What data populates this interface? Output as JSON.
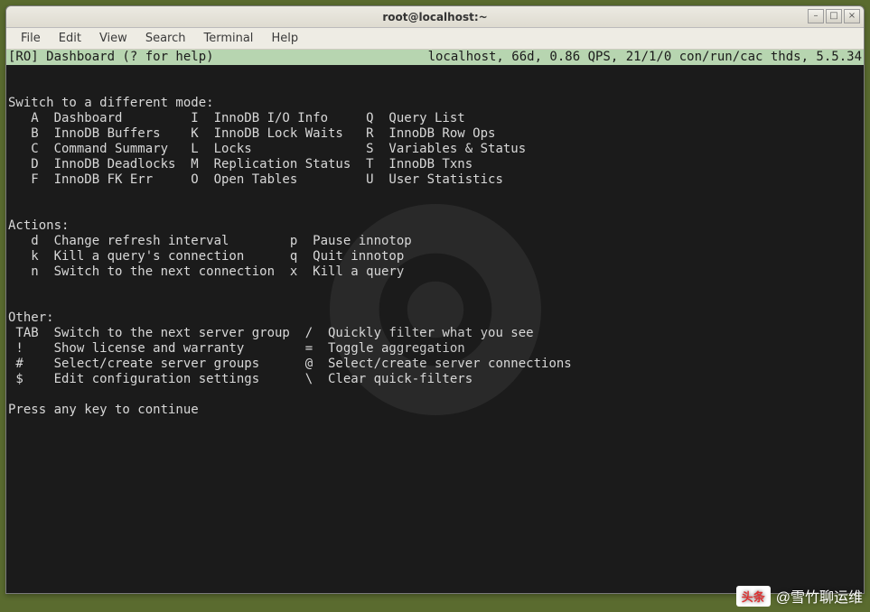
{
  "window": {
    "title": "root@localhost:~"
  },
  "menubar": [
    "File",
    "Edit",
    "View",
    "Search",
    "Terminal",
    "Help"
  ],
  "status": {
    "left": "[RO] Dashboard (? for help)",
    "right": "localhost, 66d, 0.86 QPS, 21/1/0 con/run/cac thds, 5.5.34"
  },
  "sections": {
    "modes": {
      "title": "Switch to a different mode:",
      "rows": [
        {
          "c1k": "A",
          "c1d": "Dashboard",
          "c2k": "I",
          "c2d": "InnoDB I/O Info",
          "c3k": "Q",
          "c3d": "Query List"
        },
        {
          "c1k": "B",
          "c1d": "InnoDB Buffers",
          "c2k": "K",
          "c2d": "InnoDB Lock Waits",
          "c3k": "R",
          "c3d": "InnoDB Row Ops"
        },
        {
          "c1k": "C",
          "c1d": "Command Summary",
          "c2k": "L",
          "c2d": "Locks",
          "c3k": "S",
          "c3d": "Variables & Status"
        },
        {
          "c1k": "D",
          "c1d": "InnoDB Deadlocks",
          "c2k": "M",
          "c2d": "Replication Status",
          "c3k": "T",
          "c3d": "InnoDB Txns"
        },
        {
          "c1k": "F",
          "c1d": "InnoDB FK Err",
          "c2k": "O",
          "c2d": "Open Tables",
          "c3k": "U",
          "c3d": "User Statistics"
        }
      ]
    },
    "actions": {
      "title": "Actions:",
      "rows": [
        {
          "c1k": "d",
          "c1d": "Change refresh interval",
          "c2k": "p",
          "c2d": "Pause innotop"
        },
        {
          "c1k": "k",
          "c1d": "Kill a query's connection",
          "c2k": "q",
          "c2d": "Quit innotop"
        },
        {
          "c1k": "n",
          "c1d": "Switch to the next connection",
          "c2k": "x",
          "c2d": "Kill a query"
        }
      ]
    },
    "other": {
      "title": "Other:",
      "rows": [
        {
          "c1k": "TAB",
          "c1d": "Switch to the next server group",
          "c2k": "/",
          "c2d": "Quickly filter what you see"
        },
        {
          "c1k": "!",
          "c1d": "Show license and warranty",
          "c2k": "=",
          "c2d": "Toggle aggregation"
        },
        {
          "c1k": "#",
          "c1d": "Select/create server groups",
          "c2k": "@",
          "c2d": "Select/create server connections"
        },
        {
          "c1k": "$",
          "c1d": "Edit configuration settings",
          "c2k": "\\",
          "c2d": "Clear quick-filters"
        }
      ]
    }
  },
  "prompt": "Press any key to continue",
  "attribution": {
    "badge": "头条",
    "text": "@雪竹聊运维"
  }
}
